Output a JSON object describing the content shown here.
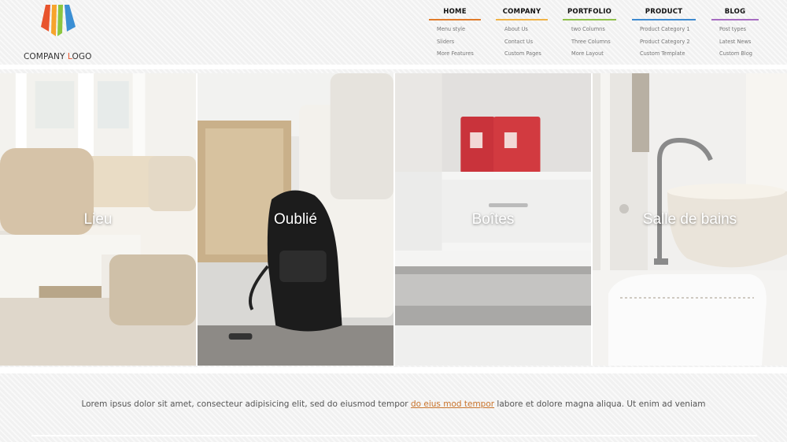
{
  "logo": {
    "text_part1": "COMPANY ",
    "text_highlight": "L",
    "text_part2": "OGO"
  },
  "nav": [
    {
      "title": "HOME",
      "color": "#e07b2a",
      "items": [
        "Menu style",
        "Sliders",
        "More Features"
      ]
    },
    {
      "title": "COMPANY",
      "color": "#f0b347",
      "items": [
        "About Us",
        "Contact Us",
        "Custom Pages"
      ]
    },
    {
      "title": "PORTFOLIO",
      "color": "#8fc04a",
      "items": [
        "two Columns",
        "Three Columns",
        "More Layout"
      ]
    },
    {
      "title": "PRODUCT",
      "color": "#3e8ad0",
      "items": [
        "Product Category 1",
        "Product Category 2",
        "Custom Template"
      ]
    },
    {
      "title": "BLOG",
      "color": "#a66cc1",
      "items": [
        "Post types",
        "Latest News",
        "Custom Blog"
      ]
    }
  ],
  "gallery": [
    {
      "label": "Lieu"
    },
    {
      "label": "Oublié"
    },
    {
      "label": "Boîtes"
    },
    {
      "label": "Salle de bains"
    }
  ],
  "intro": {
    "before": "Lorem ipsus dolor sit amet, consecteur adipisicing elit, sed do eiusmod tempor ",
    "link": "do eius mod tempor",
    "after": " labore et dolore magna aliqua. Ut enim ad veniam"
  }
}
